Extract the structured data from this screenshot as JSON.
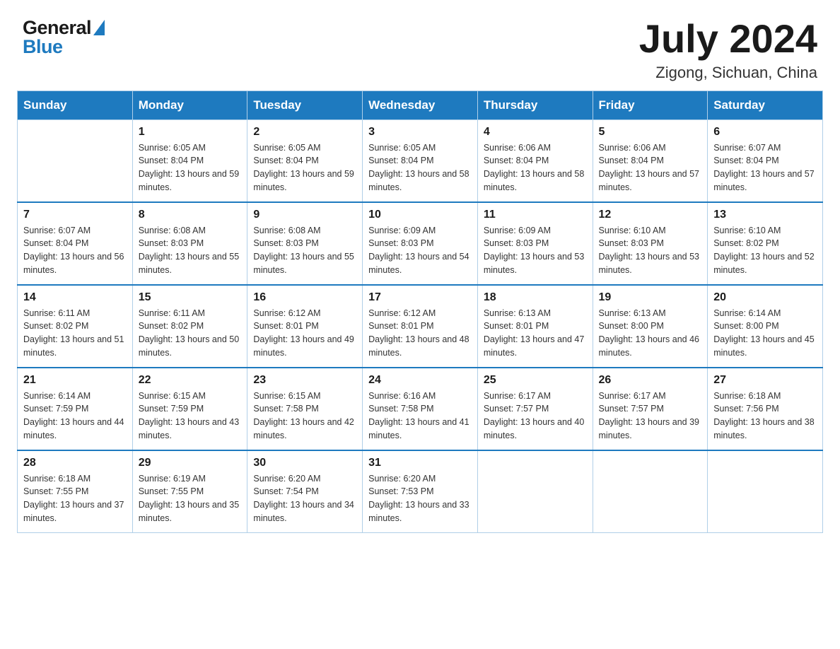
{
  "header": {
    "logo_general": "General",
    "logo_blue": "Blue",
    "month_title": "July 2024",
    "location": "Zigong, Sichuan, China"
  },
  "days_of_week": [
    "Sunday",
    "Monday",
    "Tuesday",
    "Wednesday",
    "Thursday",
    "Friday",
    "Saturday"
  ],
  "weeks": [
    [
      {
        "day": "",
        "sunrise": "",
        "sunset": "",
        "daylight": ""
      },
      {
        "day": "1",
        "sunrise": "Sunrise: 6:05 AM",
        "sunset": "Sunset: 8:04 PM",
        "daylight": "Daylight: 13 hours and 59 minutes."
      },
      {
        "day": "2",
        "sunrise": "Sunrise: 6:05 AM",
        "sunset": "Sunset: 8:04 PM",
        "daylight": "Daylight: 13 hours and 59 minutes."
      },
      {
        "day": "3",
        "sunrise": "Sunrise: 6:05 AM",
        "sunset": "Sunset: 8:04 PM",
        "daylight": "Daylight: 13 hours and 58 minutes."
      },
      {
        "day": "4",
        "sunrise": "Sunrise: 6:06 AM",
        "sunset": "Sunset: 8:04 PM",
        "daylight": "Daylight: 13 hours and 58 minutes."
      },
      {
        "day": "5",
        "sunrise": "Sunrise: 6:06 AM",
        "sunset": "Sunset: 8:04 PM",
        "daylight": "Daylight: 13 hours and 57 minutes."
      },
      {
        "day": "6",
        "sunrise": "Sunrise: 6:07 AM",
        "sunset": "Sunset: 8:04 PM",
        "daylight": "Daylight: 13 hours and 57 minutes."
      }
    ],
    [
      {
        "day": "7",
        "sunrise": "Sunrise: 6:07 AM",
        "sunset": "Sunset: 8:04 PM",
        "daylight": "Daylight: 13 hours and 56 minutes."
      },
      {
        "day": "8",
        "sunrise": "Sunrise: 6:08 AM",
        "sunset": "Sunset: 8:03 PM",
        "daylight": "Daylight: 13 hours and 55 minutes."
      },
      {
        "day": "9",
        "sunrise": "Sunrise: 6:08 AM",
        "sunset": "Sunset: 8:03 PM",
        "daylight": "Daylight: 13 hours and 55 minutes."
      },
      {
        "day": "10",
        "sunrise": "Sunrise: 6:09 AM",
        "sunset": "Sunset: 8:03 PM",
        "daylight": "Daylight: 13 hours and 54 minutes."
      },
      {
        "day": "11",
        "sunrise": "Sunrise: 6:09 AM",
        "sunset": "Sunset: 8:03 PM",
        "daylight": "Daylight: 13 hours and 53 minutes."
      },
      {
        "day": "12",
        "sunrise": "Sunrise: 6:10 AM",
        "sunset": "Sunset: 8:03 PM",
        "daylight": "Daylight: 13 hours and 53 minutes."
      },
      {
        "day": "13",
        "sunrise": "Sunrise: 6:10 AM",
        "sunset": "Sunset: 8:02 PM",
        "daylight": "Daylight: 13 hours and 52 minutes."
      }
    ],
    [
      {
        "day": "14",
        "sunrise": "Sunrise: 6:11 AM",
        "sunset": "Sunset: 8:02 PM",
        "daylight": "Daylight: 13 hours and 51 minutes."
      },
      {
        "day": "15",
        "sunrise": "Sunrise: 6:11 AM",
        "sunset": "Sunset: 8:02 PM",
        "daylight": "Daylight: 13 hours and 50 minutes."
      },
      {
        "day": "16",
        "sunrise": "Sunrise: 6:12 AM",
        "sunset": "Sunset: 8:01 PM",
        "daylight": "Daylight: 13 hours and 49 minutes."
      },
      {
        "day": "17",
        "sunrise": "Sunrise: 6:12 AM",
        "sunset": "Sunset: 8:01 PM",
        "daylight": "Daylight: 13 hours and 48 minutes."
      },
      {
        "day": "18",
        "sunrise": "Sunrise: 6:13 AM",
        "sunset": "Sunset: 8:01 PM",
        "daylight": "Daylight: 13 hours and 47 minutes."
      },
      {
        "day": "19",
        "sunrise": "Sunrise: 6:13 AM",
        "sunset": "Sunset: 8:00 PM",
        "daylight": "Daylight: 13 hours and 46 minutes."
      },
      {
        "day": "20",
        "sunrise": "Sunrise: 6:14 AM",
        "sunset": "Sunset: 8:00 PM",
        "daylight": "Daylight: 13 hours and 45 minutes."
      }
    ],
    [
      {
        "day": "21",
        "sunrise": "Sunrise: 6:14 AM",
        "sunset": "Sunset: 7:59 PM",
        "daylight": "Daylight: 13 hours and 44 minutes."
      },
      {
        "day": "22",
        "sunrise": "Sunrise: 6:15 AM",
        "sunset": "Sunset: 7:59 PM",
        "daylight": "Daylight: 13 hours and 43 minutes."
      },
      {
        "day": "23",
        "sunrise": "Sunrise: 6:15 AM",
        "sunset": "Sunset: 7:58 PM",
        "daylight": "Daylight: 13 hours and 42 minutes."
      },
      {
        "day": "24",
        "sunrise": "Sunrise: 6:16 AM",
        "sunset": "Sunset: 7:58 PM",
        "daylight": "Daylight: 13 hours and 41 minutes."
      },
      {
        "day": "25",
        "sunrise": "Sunrise: 6:17 AM",
        "sunset": "Sunset: 7:57 PM",
        "daylight": "Daylight: 13 hours and 40 minutes."
      },
      {
        "day": "26",
        "sunrise": "Sunrise: 6:17 AM",
        "sunset": "Sunset: 7:57 PM",
        "daylight": "Daylight: 13 hours and 39 minutes."
      },
      {
        "day": "27",
        "sunrise": "Sunrise: 6:18 AM",
        "sunset": "Sunset: 7:56 PM",
        "daylight": "Daylight: 13 hours and 38 minutes."
      }
    ],
    [
      {
        "day": "28",
        "sunrise": "Sunrise: 6:18 AM",
        "sunset": "Sunset: 7:55 PM",
        "daylight": "Daylight: 13 hours and 37 minutes."
      },
      {
        "day": "29",
        "sunrise": "Sunrise: 6:19 AM",
        "sunset": "Sunset: 7:55 PM",
        "daylight": "Daylight: 13 hours and 35 minutes."
      },
      {
        "day": "30",
        "sunrise": "Sunrise: 6:20 AM",
        "sunset": "Sunset: 7:54 PM",
        "daylight": "Daylight: 13 hours and 34 minutes."
      },
      {
        "day": "31",
        "sunrise": "Sunrise: 6:20 AM",
        "sunset": "Sunset: 7:53 PM",
        "daylight": "Daylight: 13 hours and 33 minutes."
      },
      {
        "day": "",
        "sunrise": "",
        "sunset": "",
        "daylight": ""
      },
      {
        "day": "",
        "sunrise": "",
        "sunset": "",
        "daylight": ""
      },
      {
        "day": "",
        "sunrise": "",
        "sunset": "",
        "daylight": ""
      }
    ]
  ]
}
